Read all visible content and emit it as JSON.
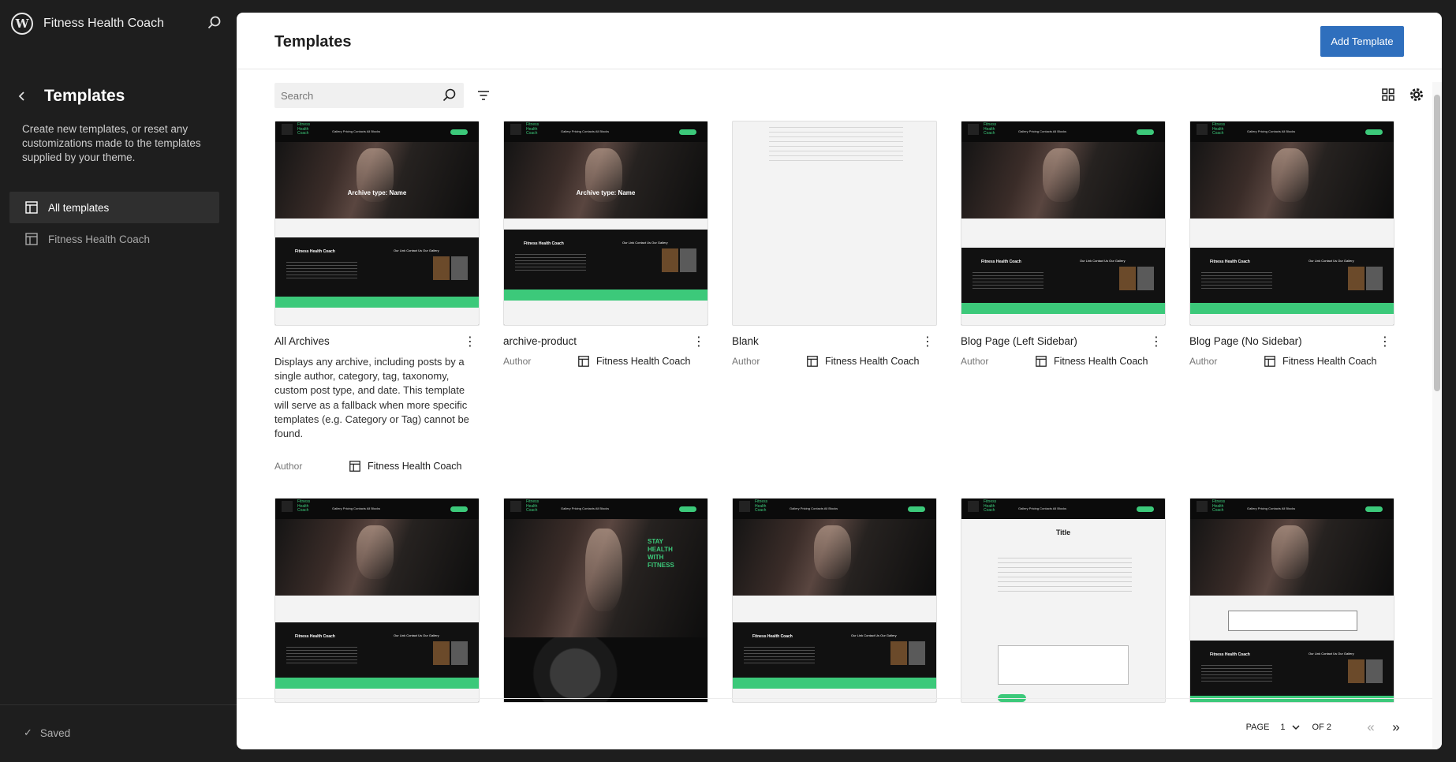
{
  "sidebar": {
    "site_name": "Fitness Health Coach",
    "title": "Templates",
    "description": "Create new templates, or reset any customizations made to the templates supplied by your theme.",
    "nav": [
      {
        "label": "All templates",
        "active": true
      },
      {
        "label": "Fitness Health Coach",
        "active": false
      }
    ],
    "status": "Saved"
  },
  "header": {
    "title": "Templates",
    "add_button": "Add Template"
  },
  "toolbar": {
    "search_placeholder": "Search"
  },
  "templates": [
    {
      "title": "All Archives",
      "description": "Displays any archive, including posts by a single author, category, tag, taxonomy, custom post type, and date. This template will serve as a fallback when more specific templates (e.g. Category or Tag) cannot be found.",
      "author_label": "Author",
      "author": "Fitness Health Coach",
      "hero_text": "Archive type: Name"
    },
    {
      "title": "archive-product",
      "author_label": "Author",
      "author": "Fitness Health Coach",
      "hero_text": "Archive type: Name"
    },
    {
      "title": "Blank",
      "author_label": "Author",
      "author": "Fitness Health Coach",
      "hero_text": ""
    },
    {
      "title": "Blog Page (Left Sidebar)",
      "author_label": "Author",
      "author": "Fitness Health Coach",
      "hero_text": ""
    },
    {
      "title": "Blog Page (No Sidebar)",
      "author_label": "Author",
      "author": "Fitness Health Coach",
      "hero_text": ""
    }
  ],
  "thumb_text": {
    "site": "Fitness Health Coach",
    "links": "Gallery  Pricing  Contacts  All Blocks",
    "footer_title": "Fitness Health Coach",
    "cols": "Our Link     Contact Us     Our Gallery",
    "second_row_title": "Title",
    "second_row_hero": "STAY HEALTH WITH FITNESS"
  },
  "pagination": {
    "page_label": "PAGE",
    "current": "1",
    "of_label": "OF 2"
  },
  "icons": {
    "logo": "wordpress-icon",
    "search": "search-icon",
    "back": "chevron-left-icon",
    "filter": "filter-icon",
    "grid": "grid-view-icon",
    "settings": "gear-icon",
    "layout": "layout-icon",
    "more": "more-vertical-icon"
  }
}
